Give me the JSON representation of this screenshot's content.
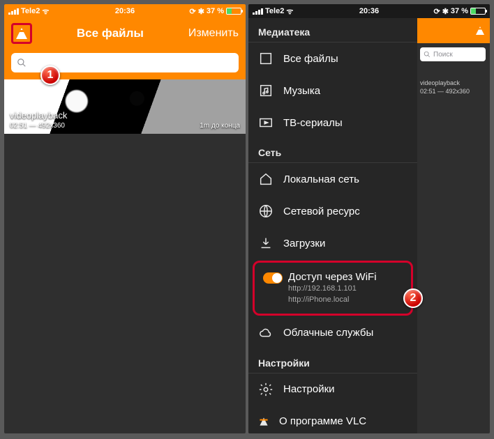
{
  "status": {
    "carrier": "Tele2",
    "time": "20:36",
    "battery": "37 %"
  },
  "left": {
    "title": "Все файлы",
    "edit": "Изменить",
    "search_placeholder": "",
    "video": {
      "name": "videoplayback",
      "meta": "02:51 — 492x360",
      "remaining": "1m до конца"
    },
    "badge": "1"
  },
  "right": {
    "badge": "2",
    "sections": {
      "media": "Медиатека",
      "network": "Сеть",
      "settings": "Настройки"
    },
    "items": {
      "all": "Все файлы",
      "music": "Музыка",
      "tv": "ТВ-сериалы",
      "lan": "Локальная сеть",
      "netres": "Сетевой ресурс",
      "downloads": "Загрузки",
      "wifi": {
        "title": "Доступ через WiFi",
        "url1": "http://192.168.1.101",
        "url2": "http://iPhone.local"
      },
      "cloud": "Облачные службы",
      "prefs": "Настройки",
      "about": "О программе VLC"
    },
    "peek": {
      "search": "Поиск",
      "video": "videoplayback",
      "meta": "02:51 — 492x360"
    }
  }
}
